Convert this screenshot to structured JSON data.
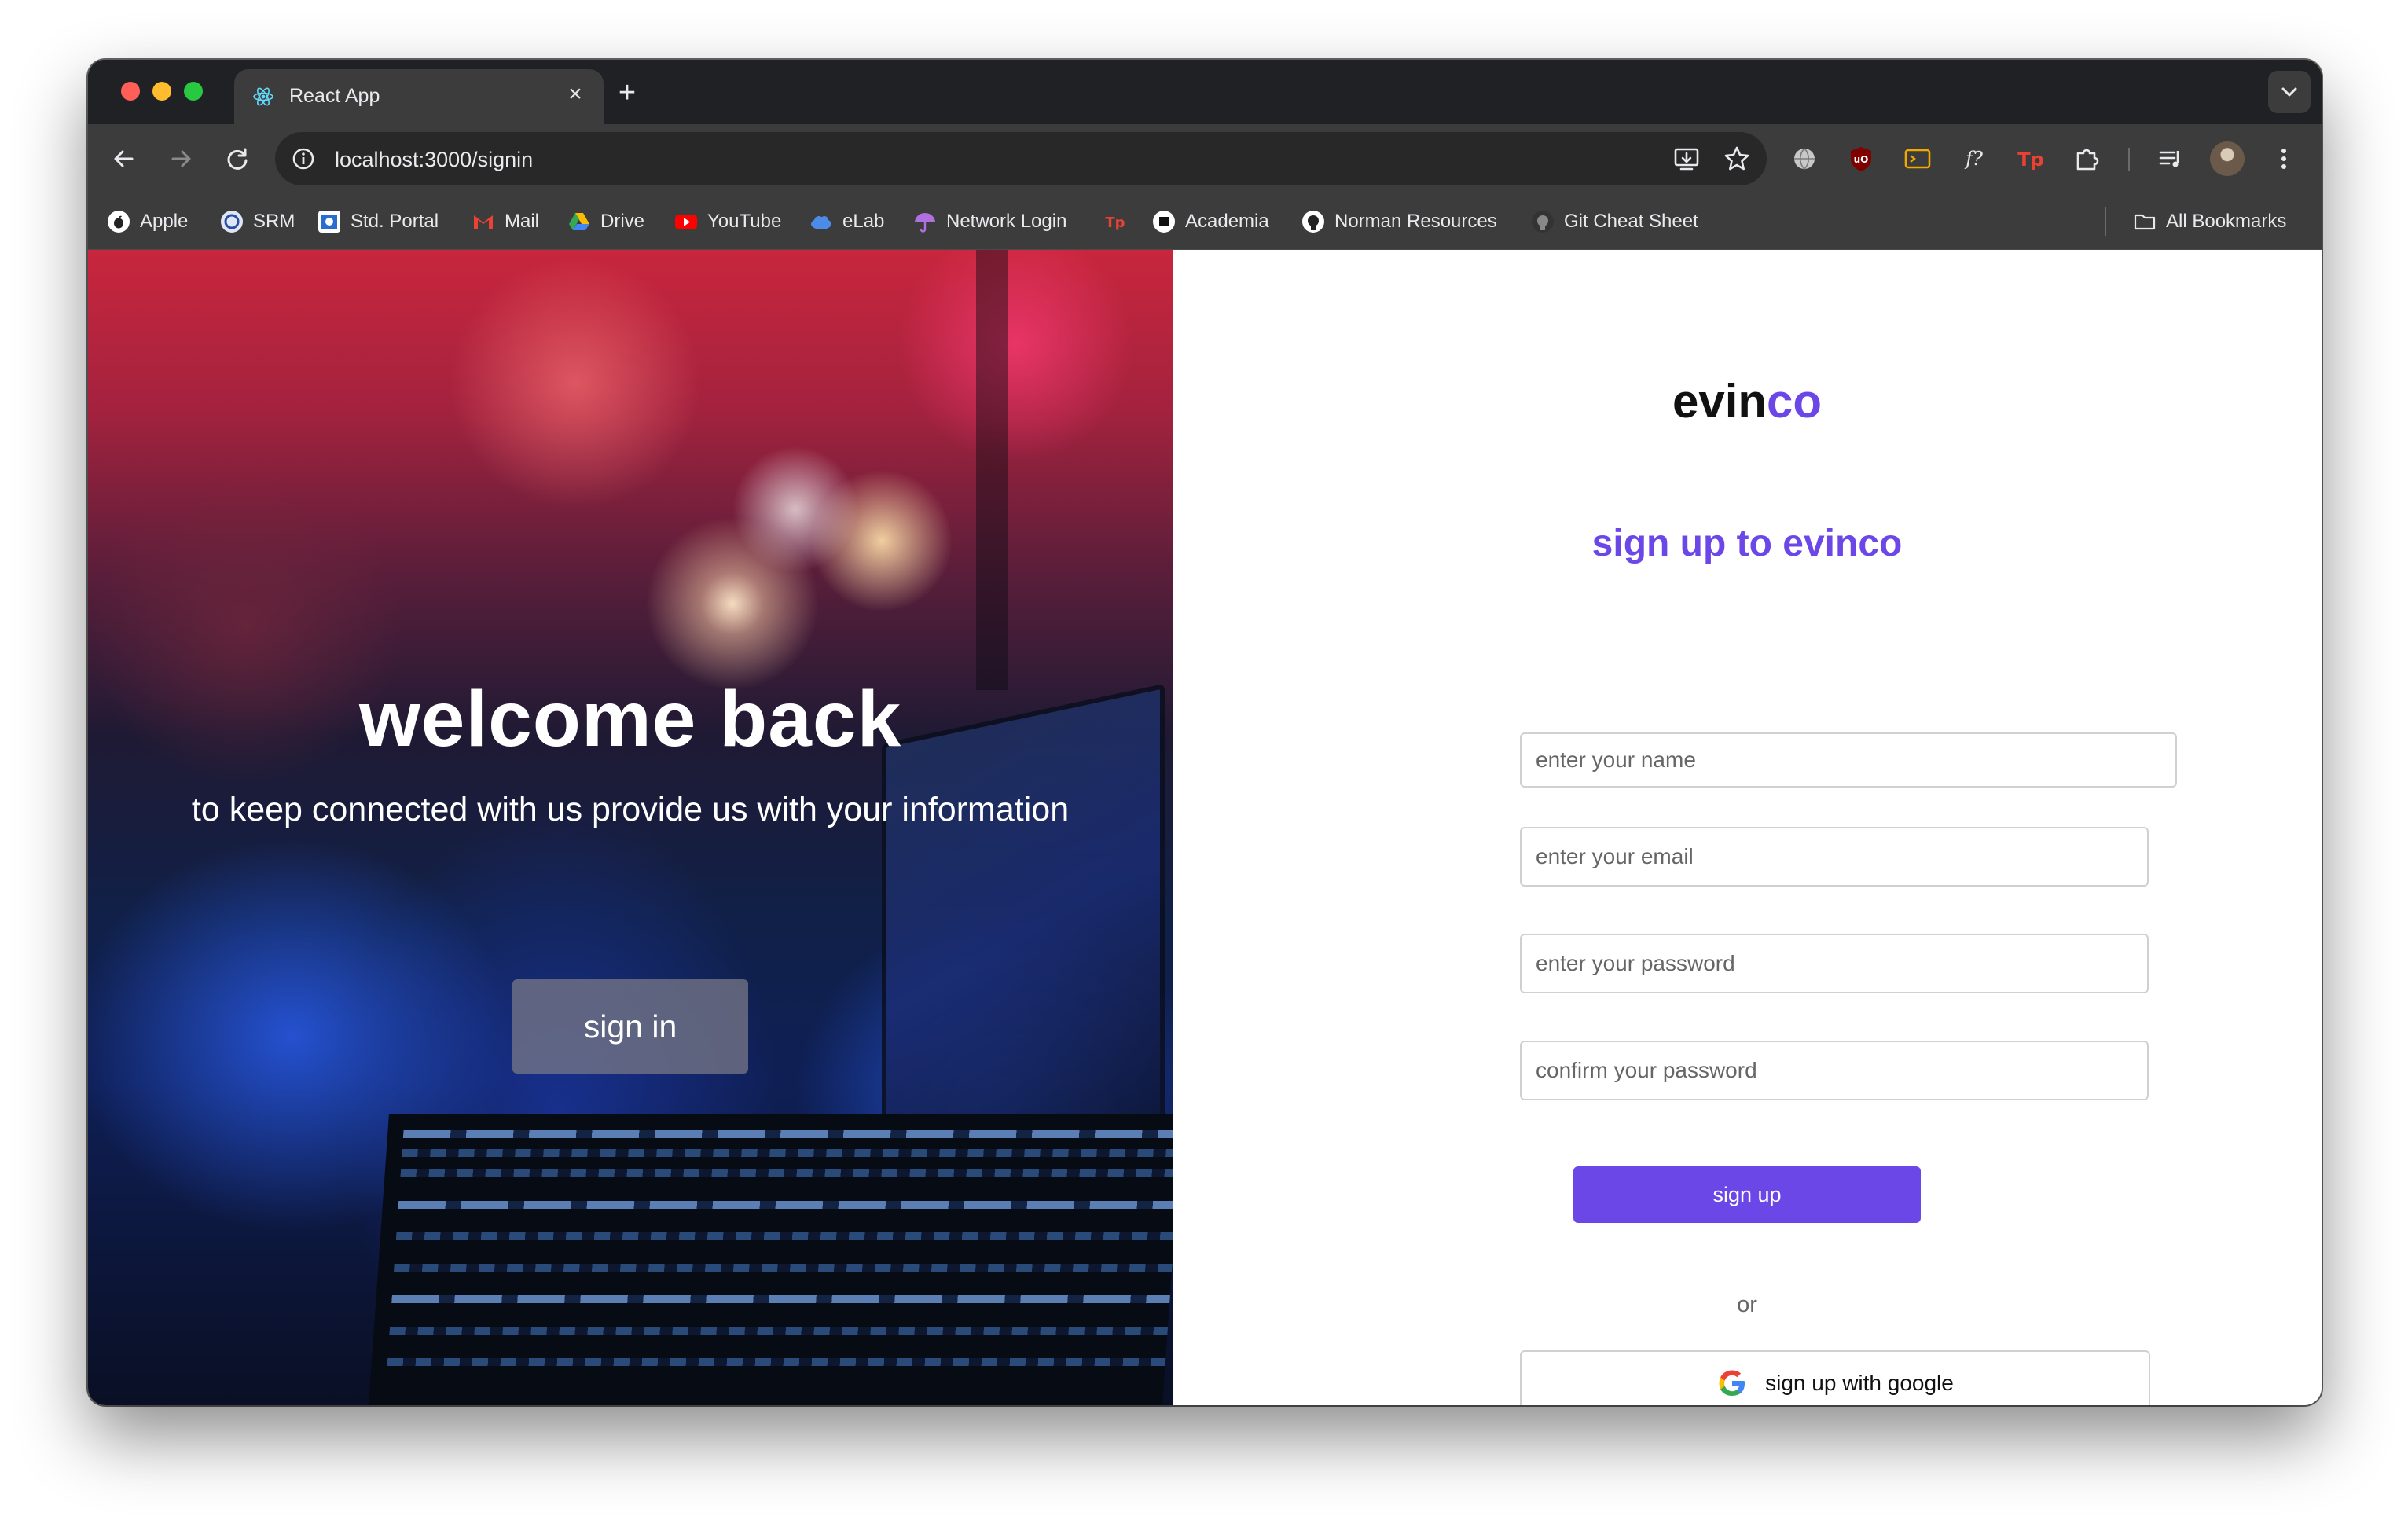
{
  "browser": {
    "tab_title": "React App",
    "new_tab_label": "+",
    "close_label": "×",
    "url": "localhost:3000/signin"
  },
  "bookmarks": {
    "items": [
      "Apple",
      "SRM",
      "Std. Portal",
      "Mail",
      "Drive",
      "YouTube",
      "eLab",
      "Network Login",
      "Academia",
      "Norman Resources",
      "Git Cheat Sheet"
    ],
    "all_bookmarks": "All Bookmarks"
  },
  "hero": {
    "title": "welcome back",
    "subtitle": "to keep connected with us provide us with your information",
    "signin_label": "sign in"
  },
  "form": {
    "brand_prefix": "evin",
    "brand_suffix": "co",
    "heading": "sign up to evinco",
    "name_placeholder": "enter your name",
    "email_placeholder": "enter your email",
    "password_placeholder": "enter your password",
    "confirm_placeholder": "confirm your password",
    "signup_label": "sign up",
    "or_label": "or",
    "google_label": "sign up with google"
  },
  "colors": {
    "accent": "#6c47e8",
    "chrome_dark": "#202124",
    "chrome_toolbar": "#3c3c3c"
  }
}
